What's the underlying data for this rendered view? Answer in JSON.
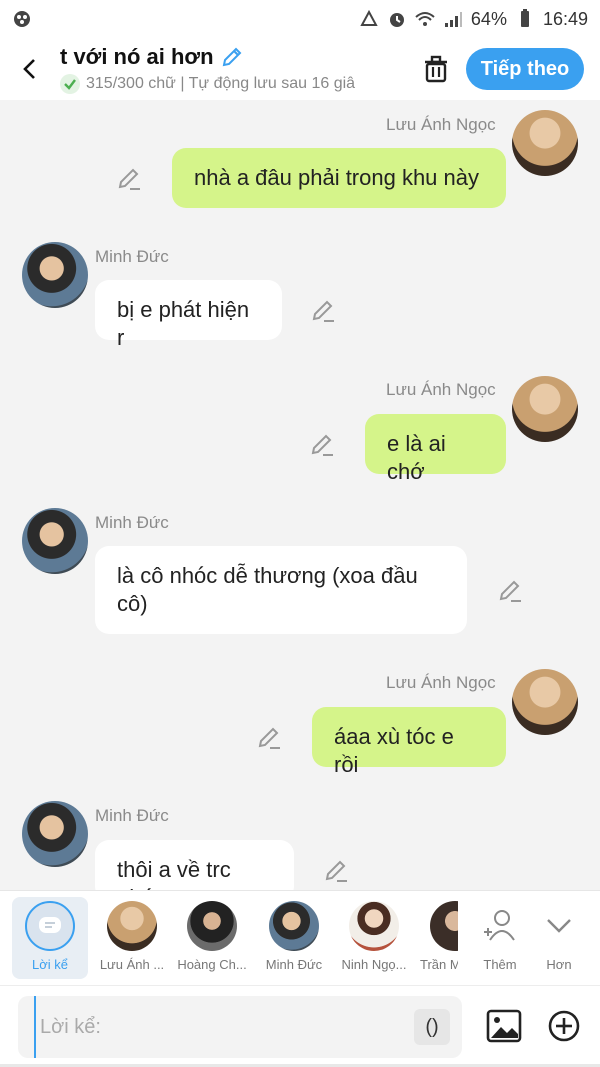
{
  "status": {
    "battery": "64%",
    "time": "16:49"
  },
  "header": {
    "title": "t với nó ai hơn",
    "subtitle": "315/300 chữ | Tự động lưu sau 16 giâ",
    "next_label": "Tiếp theo"
  },
  "messages": [
    {
      "side": "me",
      "sender": "Lưu Ánh Ngọc",
      "text": "nhà a đâu phải trong khu này"
    },
    {
      "side": "other",
      "sender": "Minh Đức",
      "text": "bị e phát hiện r"
    },
    {
      "side": "me",
      "sender": "Lưu Ánh Ngọc",
      "text": "e là ai chớ"
    },
    {
      "side": "other",
      "sender": "Minh Đức",
      "text": "là cô nhóc dễ thương (xoa đầu cô)"
    },
    {
      "side": "me",
      "sender": "Lưu Ánh Ngọc",
      "text": "áaa xù tóc e rồi"
    },
    {
      "side": "other",
      "sender": "Minh Đức",
      "text": "thôi a về trc nhé"
    }
  ],
  "characters": [
    {
      "label": "Lời kể"
    },
    {
      "label": "Lưu Ánh ..."
    },
    {
      "label": "Hoàng Ch..."
    },
    {
      "label": "Minh Đức"
    },
    {
      "label": "Ninh Ngọ..."
    },
    {
      "label": "Trần M"
    },
    {
      "label": "Thêm"
    },
    {
      "label": "Hơn"
    }
  ],
  "input": {
    "placeholder": "Lời kể:",
    "paren_label": "()"
  },
  "colors": {
    "accent": "#3aa0f0",
    "my_bubble": "#d5f48a",
    "other_bubble": "#ffffff",
    "background": "#f3f3f3"
  },
  "icons": [
    "back-arrow-icon",
    "pencil-icon",
    "check-icon",
    "trash-icon",
    "image-icon",
    "plus-circle-icon",
    "add-person-icon",
    "chevron-down-icon"
  ]
}
